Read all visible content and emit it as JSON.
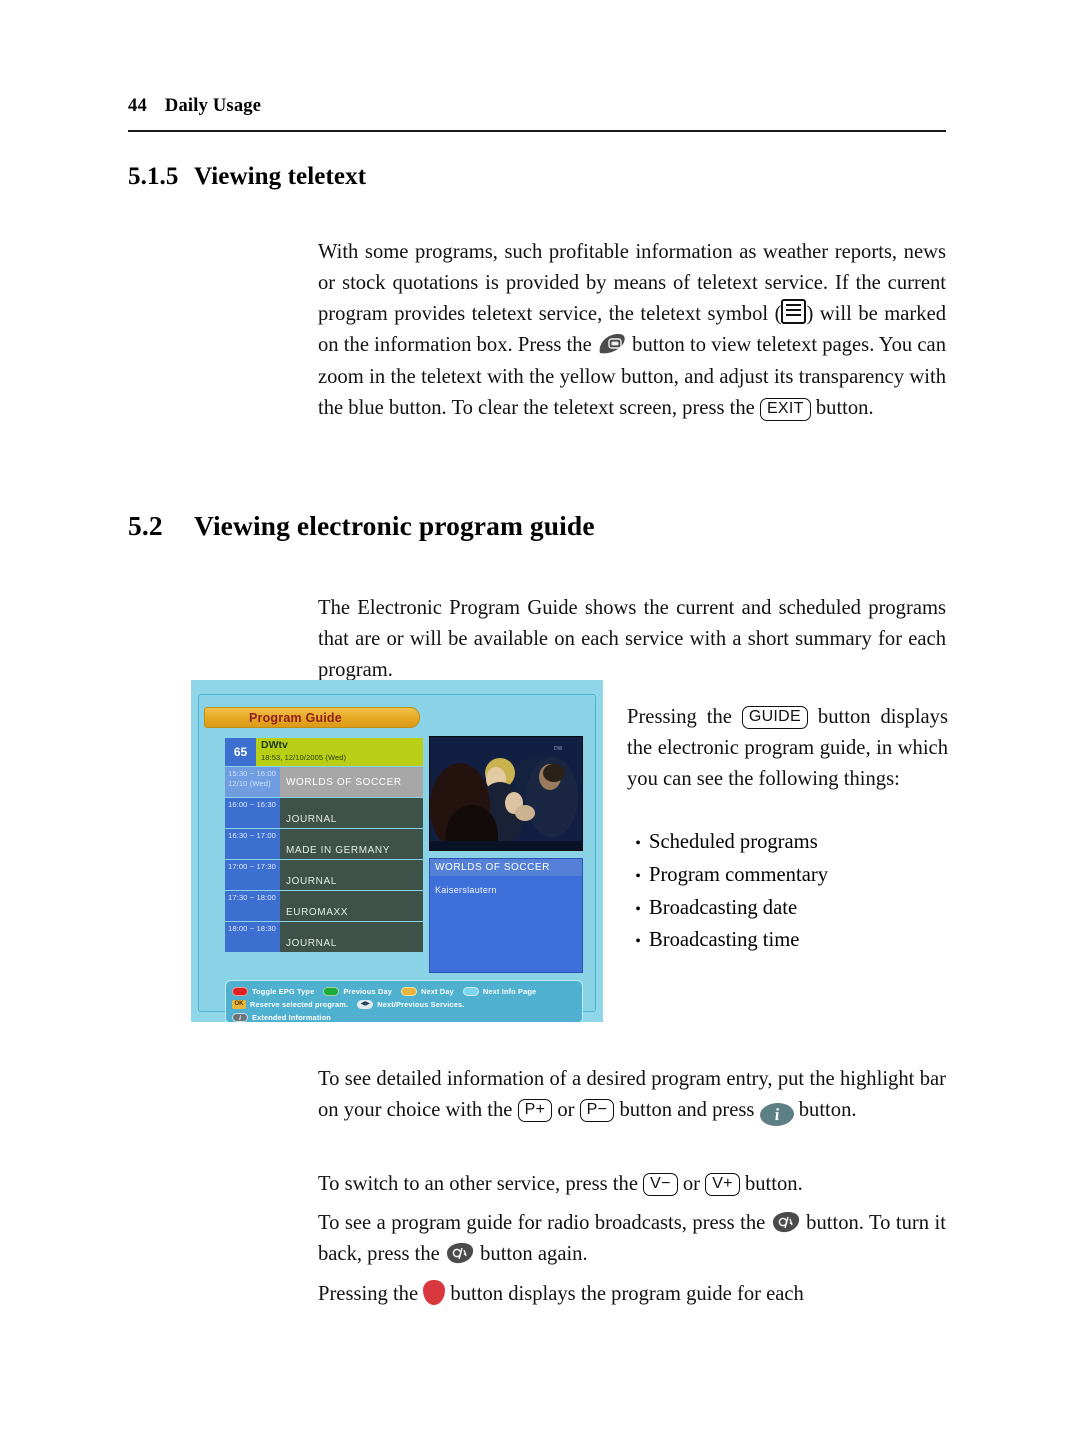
{
  "header": {
    "page_number": "44",
    "section_title": "Daily Usage"
  },
  "headings": {
    "h3_number": "5.1.5",
    "h3_title": "Viewing teletext",
    "h2_number": "5.2",
    "h2_title": "Viewing electronic program guide"
  },
  "paragraphs": {
    "teletext_1": "With some programs, such profitable information as weather reports, news or stock quotations is provided by means of teletext service. If the current program provides teletext service, the teletext symbol (",
    "teletext_2": ") will be marked on the information box. Press the ",
    "teletext_3": " button to view teletext pages. You can zoom in the teletext with the yellow button, and adjust its transparency with the blue button. To clear the teletext screen, press the ",
    "teletext_4": " button.",
    "epg_intro": "The Electronic Program Guide shows the current and scheduled programs that are or will be available on each service with a short summary for each program.",
    "guide_1": "Pressing the ",
    "guide_2": " button displays the electronic program guide, in which you can see the following things:",
    "detail_1": "To see detailed information of a desired program entry, put the highlight bar on your choice with the ",
    "detail_2": " or ",
    "detail_3": " button and press ",
    "detail_4": " button.",
    "switch_1": "To switch to an other service, press the ",
    "switch_2": " or ",
    "switch_3": " button.",
    "radio_1": "To see a program guide for radio broadcasts, press the ",
    "radio_2": " button. To turn it back, press the ",
    "radio_3": " button again.",
    "redbtn_1": "Pressing the ",
    "redbtn_2": " button displays the program guide for each"
  },
  "keys": {
    "exit": "EXIT",
    "guide": "GUIDE",
    "p_plus": "P+",
    "p_minus": "P−",
    "v_minus": "V−",
    "v_plus": "V+",
    "info_letter": "i"
  },
  "bullets": [
    {
      "marker": "•",
      "label": "Scheduled programs"
    },
    {
      "marker": "•",
      "label": "Program commentary"
    },
    {
      "marker": "•",
      "label": "Broadcasting date"
    },
    {
      "marker": "•",
      "label": "Broadcasting time"
    }
  ],
  "epg": {
    "title": "Program Guide",
    "channel": {
      "number": "65",
      "name": "DWtv",
      "datetime": "18:53, 12/10/2005 (Wed)"
    },
    "rows": [
      {
        "time": "15:30 ~ 16:00",
        "date": "12/10 (Wed)",
        "program": "WORLDS OF SOCCER",
        "selected": true
      },
      {
        "time": "16:00 ~ 16:30",
        "date": "",
        "program": "JOURNAL",
        "selected": false
      },
      {
        "time": "16:30 ~ 17:00",
        "date": "",
        "program": "MADE IN GERMANY",
        "selected": false
      },
      {
        "time": "17:00 ~ 17:30",
        "date": "",
        "program": "JOURNAL",
        "selected": false
      },
      {
        "time": "17:30 ~ 18:00",
        "date": "",
        "program": "EUROMAXX",
        "selected": false
      },
      {
        "time": "18:00 ~ 18:30",
        "date": "",
        "program": "JOURNAL",
        "selected": false
      }
    ],
    "video_logo": "DW",
    "info": {
      "title": "WORLDS OF SOCCER",
      "body": "Kaiserslautern"
    },
    "legend": {
      "line1": [
        {
          "type": "color",
          "color": "#e02020",
          "label": "Toggle EPG Type"
        },
        {
          "type": "color",
          "color": "#1faa3a",
          "label": "Previous Day"
        },
        {
          "type": "color",
          "color": "#e8b63a",
          "label": "Next Day"
        },
        {
          "type": "color",
          "color": "#7fd4ee",
          "label": "Next Info Page"
        }
      ],
      "line2": [
        {
          "type": "ok",
          "glyph": "OK",
          "label": "Reserve selected program."
        },
        {
          "type": "arrows",
          "glyph": "◀▶",
          "label": "Next/Previous Services."
        }
      ],
      "line3": [
        {
          "type": "info",
          "glyph": "i",
          "label": "Extended Information"
        }
      ]
    }
  },
  "colors": {
    "epg_background": "#8fd6e8",
    "epg_titlebar": "#e6a822",
    "epg_title_text": "#8f2020",
    "channel_bar": "#b9cf16",
    "time_cell": "#3d6fd0",
    "program_cell": "#3d5249",
    "selected_cell": "#a6a6a6",
    "info_panel": "#3f6fd8",
    "legend_bar": "#4fb0d0",
    "red_button": "#d9383f",
    "info_button": "#5d7f86"
  }
}
